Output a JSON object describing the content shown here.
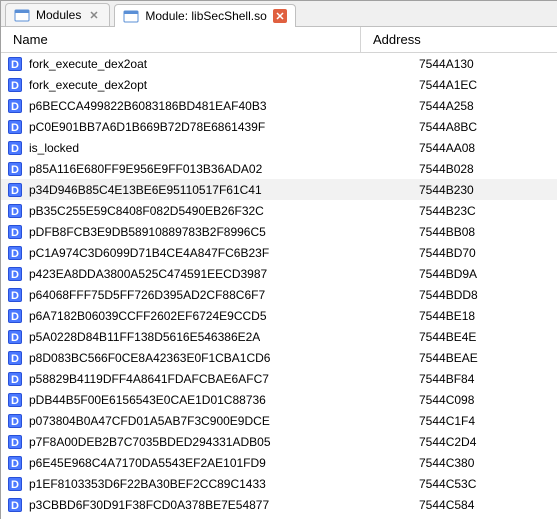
{
  "tabs": {
    "modules": {
      "label": "Modules"
    },
    "module_detail": {
      "label": "Module: libSecShell.so"
    }
  },
  "columns": {
    "name": "Name",
    "address": "Address"
  },
  "highlight_index": 6,
  "rows": [
    {
      "name": "fork_execute_dex2oat",
      "address": "7544A130"
    },
    {
      "name": "fork_execute_dex2opt",
      "address": "7544A1EC"
    },
    {
      "name": "p6BECCA499822B6083186BD481EAF40B3",
      "address": "7544A258"
    },
    {
      "name": "pC0E901BB7A6D1B669B72D78E6861439F",
      "address": "7544A8BC"
    },
    {
      "name": "is_locked",
      "address": "7544AA08"
    },
    {
      "name": "p85A116E680FF9E956E9FF013B36ADA02",
      "address": "7544B028"
    },
    {
      "name": "p34D946B85C4E13BE6E95110517F61C41",
      "address": "7544B230"
    },
    {
      "name": "pB35C255E59C8408F082D5490EB26F32C",
      "address": "7544B23C"
    },
    {
      "name": "pDFB8FCB3E9DB58910889783B2F8996C5",
      "address": "7544BB08"
    },
    {
      "name": "pC1A974C3D6099D71B4CE4A847FC6B23F",
      "address": "7544BD70"
    },
    {
      "name": "p423EA8DDA3800A525C474591EECD3987",
      "address": "7544BD9A"
    },
    {
      "name": "p64068FFF75D5FF726D395AD2CF88C6F7",
      "address": "7544BDD8"
    },
    {
      "name": "p6A7182B06039CCFF2602EF6724E9CCD5",
      "address": "7544BE18"
    },
    {
      "name": "p5A0228D84B11FF138D5616E546386E2A",
      "address": "7544BE4E"
    },
    {
      "name": "p8D083BC566F0CE8A42363E0F1CBA1CD6",
      "address": "7544BEAE"
    },
    {
      "name": "p58829B4119DFF4A8641FDAFCBAE6AFC7",
      "address": "7544BF84"
    },
    {
      "name": "pDB44B5F00E6156543E0CAE1D01C88736",
      "address": "7544C098"
    },
    {
      "name": "p073804B0A47CFD01A5AB7F3C900E9DCE",
      "address": "7544C1F4"
    },
    {
      "name": "p7F8A00DEB2B7C7035BDED294331ADB05",
      "address": "7544C2D4"
    },
    {
      "name": "p6E45E968C4A7170DA5543EF2AE101FD9",
      "address": "7544C380"
    },
    {
      "name": "p1EF8103353D6F22BA30BEF2CC89C1433",
      "address": "7544C53C"
    },
    {
      "name": "p3CBBD6F30D91F38FCD0A378BE7E54877",
      "address": "7544C584"
    }
  ]
}
